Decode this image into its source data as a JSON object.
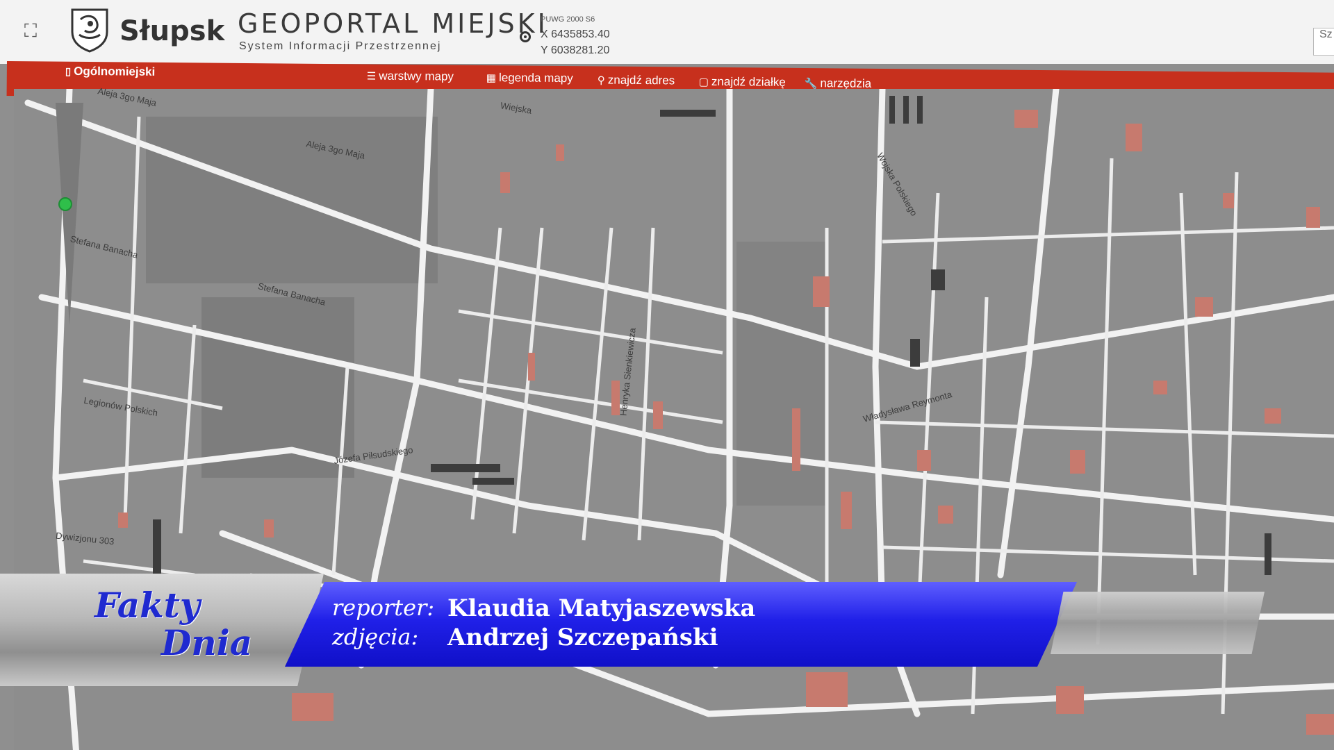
{
  "header": {
    "city_name": "Słupsk",
    "portal_title": "GEOPORTAL MIEJSKI",
    "portal_subtitle": "System Informacji Przestrzennej",
    "coordinate_system": "PUWG 2000 S6",
    "coord_x": "X 6435853.40",
    "coord_y": "Y 6038281.20",
    "search_stub": "Sz"
  },
  "toolbar": {
    "general": "Ogólnomiejski",
    "layers": "warstwy mapy",
    "legend": "legenda mapy",
    "find_address": "znajdź adres",
    "find_plot": "znajdź działkę",
    "tools": "narzędzia"
  },
  "map": {
    "streets": [
      "Aleja 3go Maja",
      "Aleja 3go Maja",
      "Stefana Banacha",
      "Stefana Banacha",
      "Legionów Polskich",
      "Józefa Piłsudskiego",
      "Dywizjonu 303",
      "Wojska Polskiego",
      "Władysława Reymonta",
      "Henryka Sienkiewicza",
      "Wiejska"
    ]
  },
  "overlay": {
    "logo_line1": "Fakty",
    "logo_line2": "Dnia",
    "reporter_label": "reporter:",
    "reporter_name": "Klaudia Matyjaszewska",
    "camera_label": "zdjęcia:",
    "camera_name": "Andrzej Szczepański"
  },
  "colors": {
    "toolbar_red": "#c7301d",
    "band_blue": "#2020e8",
    "logo_blue": "#1f2ad0",
    "building_red": "#c77a6e"
  }
}
